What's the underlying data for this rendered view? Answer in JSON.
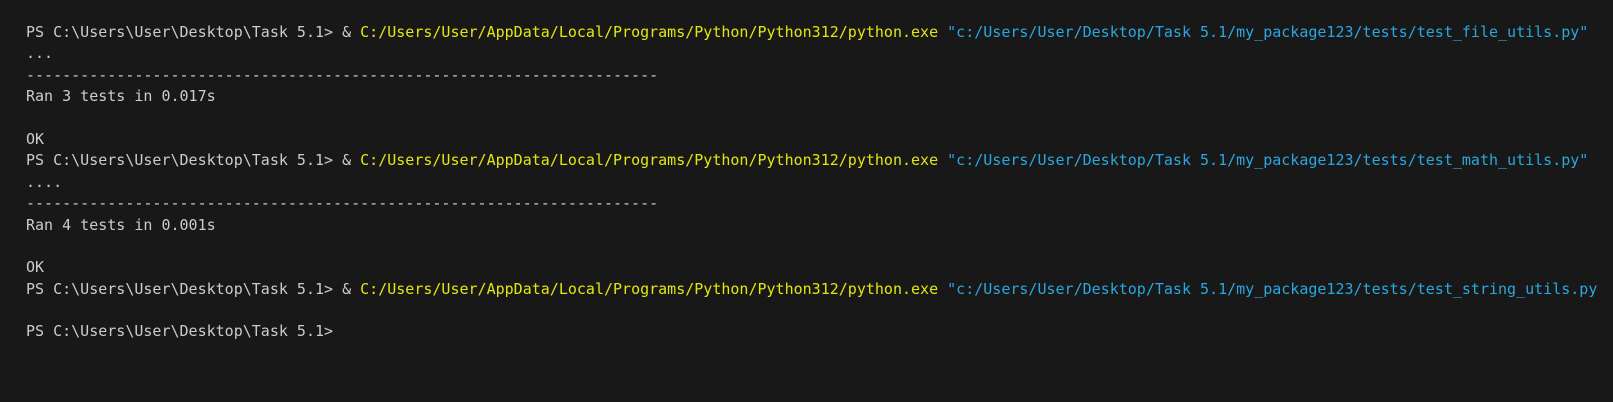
{
  "terminal": {
    "prompt": "PS C:\\Users\\User\\Desktop\\Task 5.1> ",
    "amp": "& ",
    "python_exe": "C:/Users/User/AppData/Local/Programs/Python/Python312/python.exe",
    "runs": [
      {
        "script": "\"c:/Users/User/Desktop/Task 5.1/my_package123/tests/test_file_utils.py\"",
        "dots": "...",
        "separator": "----------------------------------------------------------------------",
        "summary": "Ran 3 tests in 0.017s",
        "result": "OK"
      },
      {
        "script": "\"c:/Users/User/Desktop/Task 5.1/my_package123/tests/test_math_utils.py\"",
        "dots": "....",
        "separator": "----------------------------------------------------------------------",
        "summary": "Ran 4 tests in 0.001s",
        "result": "OK"
      },
      {
        "script": "\"c:/Users/User/Desktop/Task 5.1/my_package123/tests/test_string_utils.py\""
      }
    ],
    "final_prompt": "PS C:\\Users\\User\\Desktop\\Task 5.1>"
  },
  "colors": {
    "background": "#181818",
    "text": "#cccccc",
    "executable": "#e5e510",
    "argument": "#2aa7e0"
  }
}
